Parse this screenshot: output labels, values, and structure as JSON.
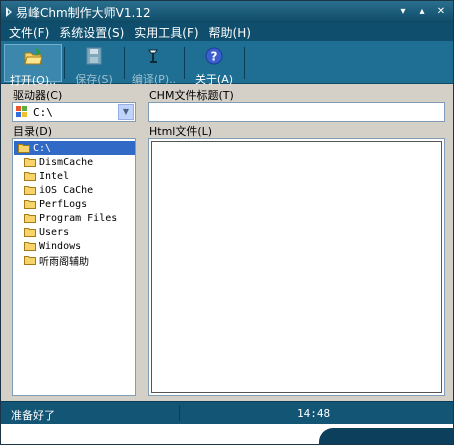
{
  "window": {
    "title": "易峰Chm制作大师V1.12"
  },
  "menu": [
    "文件(F)",
    "系统设置(S)",
    "实用工具(F)",
    "帮助(H)"
  ],
  "toolbar": [
    {
      "label": "打开(O)..",
      "icon": "open-folder-icon",
      "enabled": true
    },
    {
      "label": "保存(S)",
      "icon": "save-disk-icon",
      "enabled": false
    },
    {
      "label": "编译(P)..",
      "icon": "compile-icon",
      "enabled": false
    },
    {
      "label": "关于(A)",
      "icon": "help-icon",
      "enabled": true
    }
  ],
  "drive": {
    "label": "驱动器(C)",
    "value": "C:\\"
  },
  "chm_title": {
    "label": "CHM文件标题(T)",
    "value": ""
  },
  "dir": {
    "label": "目录(D)",
    "root": "C:\\",
    "items": [
      "DismCache",
      "Intel",
      "iOS CaChe",
      "PerfLogs",
      "Program Files",
      "Users",
      "Windows",
      "听雨阁辅助"
    ]
  },
  "html_files": {
    "label": "Html文件(L)"
  },
  "status": {
    "text": "准备好了",
    "time": "14:48"
  },
  "colors": {
    "title_bar": "#0e4a66",
    "toolbar": "#1f6f94",
    "status_bar": "#135575",
    "selection": "#3169c6"
  }
}
